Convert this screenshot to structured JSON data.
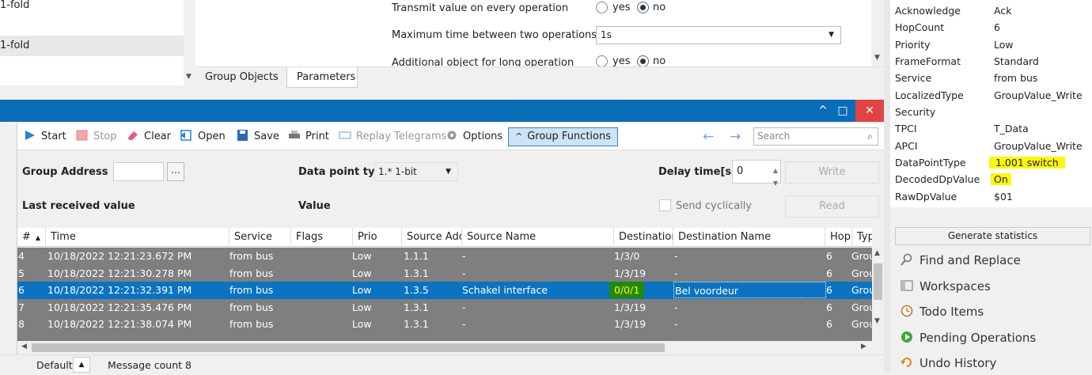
{
  "left_list": {
    "items": [
      "1-fold",
      "1-fold"
    ]
  },
  "params": {
    "rows": [
      {
        "label": "Transmit value on every operation",
        "opt1": "yes",
        "opt2": "no"
      },
      {
        "label": "Maximum time between two operations",
        "value": "1s"
      },
      {
        "label": "Additional object for long operation",
        "opt1": "yes",
        "opt2": "no"
      }
    ],
    "tabs": [
      "Group Objects",
      "Parameters"
    ]
  },
  "window": {
    "minimize": "^",
    "maximize": "□",
    "close": "✕"
  },
  "toolbar": {
    "start": "Start",
    "stop": "Stop",
    "clear": "Clear",
    "open": "Open",
    "save": "Save",
    "print": "Print",
    "replay": "Replay Telegrams",
    "options": "Options",
    "group_functions": "Group Functions",
    "search_placeholder": "Search"
  },
  "filter": {
    "group_address": "Group Address",
    "browse": "...",
    "dpt_label": "Data point type",
    "dpt_value": "1.* 1-bit",
    "delay_label": "Delay time[sec]",
    "delay_value": "0",
    "write": "Write",
    "read": "Read",
    "last_received": "Last received value",
    "value": "Value",
    "send_cyclically": "Send cyclically"
  },
  "table": {
    "headers": [
      "#",
      "Time",
      "Service",
      "Flags",
      "Prio",
      "Source Addr",
      "Source Name",
      "Destination",
      "Destination Name",
      "Hop",
      "Typ"
    ],
    "rows": [
      {
        "n": "4",
        "time": "10/18/2022 12:21:23.672 PM",
        "service": "from bus",
        "flags": "",
        "prio": "Low",
        "src": "1.1.1",
        "srcname": "-",
        "dest": "1/3/0",
        "destname": "-",
        "hop": "6",
        "type": "Grou"
      },
      {
        "n": "5",
        "time": "10/18/2022 12:21:30.278 PM",
        "service": "from bus",
        "flags": "",
        "prio": "Low",
        "src": "1.3.1",
        "srcname": "-",
        "dest": "1/3/19",
        "destname": "-",
        "hop": "6",
        "type": "Grou"
      },
      {
        "n": "6",
        "time": "10/18/2022 12:21:32.391 PM",
        "service": "from bus",
        "flags": "",
        "prio": "Low",
        "src": "1.3.5",
        "srcname": "Schakel interface",
        "dest": "0/0/1",
        "destname": "Bel voordeur",
        "hop": "6",
        "type": "Grou"
      },
      {
        "n": "7",
        "time": "10/18/2022 12:21:35.476 PM",
        "service": "from bus",
        "flags": "",
        "prio": "Low",
        "src": "1.3.1",
        "srcname": "-",
        "dest": "1/3/19",
        "destname": "-",
        "hop": "6",
        "type": "Grou"
      },
      {
        "n": "8",
        "time": "10/18/2022 12:21:38.074 PM",
        "service": "from bus",
        "flags": "",
        "prio": "Low",
        "src": "1.3.1",
        "srcname": "-",
        "dest": "1/3/19",
        "destname": "-",
        "hop": "6",
        "type": "Grou"
      }
    ]
  },
  "status": {
    "layout": "Default",
    "message_count": "Message count 8"
  },
  "properties": [
    {
      "k": "Acknowledge",
      "v": "Ack"
    },
    {
      "k": "HopCount",
      "v": "6"
    },
    {
      "k": "Priority",
      "v": "Low"
    },
    {
      "k": "FrameFormat",
      "v": "Standard"
    },
    {
      "k": "Service",
      "v": "from bus"
    },
    {
      "k": "LocalizedType",
      "v": "GroupValue_Write"
    },
    {
      "k": "Security",
      "v": ""
    },
    {
      "k": "TPCI",
      "v": "T_Data"
    },
    {
      "k": "APCI",
      "v": "GroupValue_Write"
    },
    {
      "k": "DataPointType",
      "v": "1.001 switch"
    },
    {
      "k": "DecodedDpValue",
      "v": "On"
    },
    {
      "k": "RawDpValue",
      "v": "$01"
    }
  ],
  "generate_statistics": "Generate statistics",
  "side_panels": [
    "Find and Replace",
    "Workspaces",
    "Todo Items",
    "Pending Operations",
    "Undo History"
  ],
  "colors": {
    "title_bar": "#0a6db8",
    "selected_row": "#0b73c1",
    "row_bg": "#7f7f7f",
    "highlight": "#fbf80d",
    "dest_highlight": "#1f8a12"
  }
}
